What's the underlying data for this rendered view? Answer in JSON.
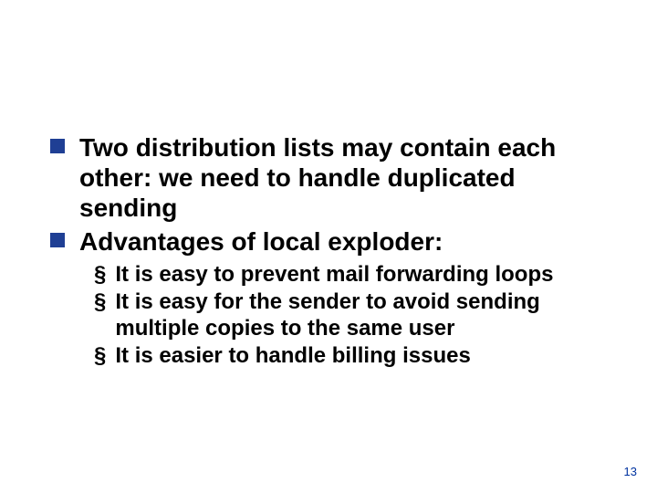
{
  "colors": {
    "bullet_fill": "#1f3f94",
    "page_num": "#0033a0"
  },
  "bullets": [
    {
      "text": "Two distribution lists may contain each other: we need to handle duplicated sending",
      "sub": []
    },
    {
      "text": "Advantages of local exploder:",
      "sub": [
        "It is easy to prevent mail forwarding loops",
        "It is easy for the sender to avoid sending multiple copies to the same user",
        "It is easier to handle billing issues"
      ]
    }
  ],
  "page_number": "13",
  "section_mark": "§"
}
